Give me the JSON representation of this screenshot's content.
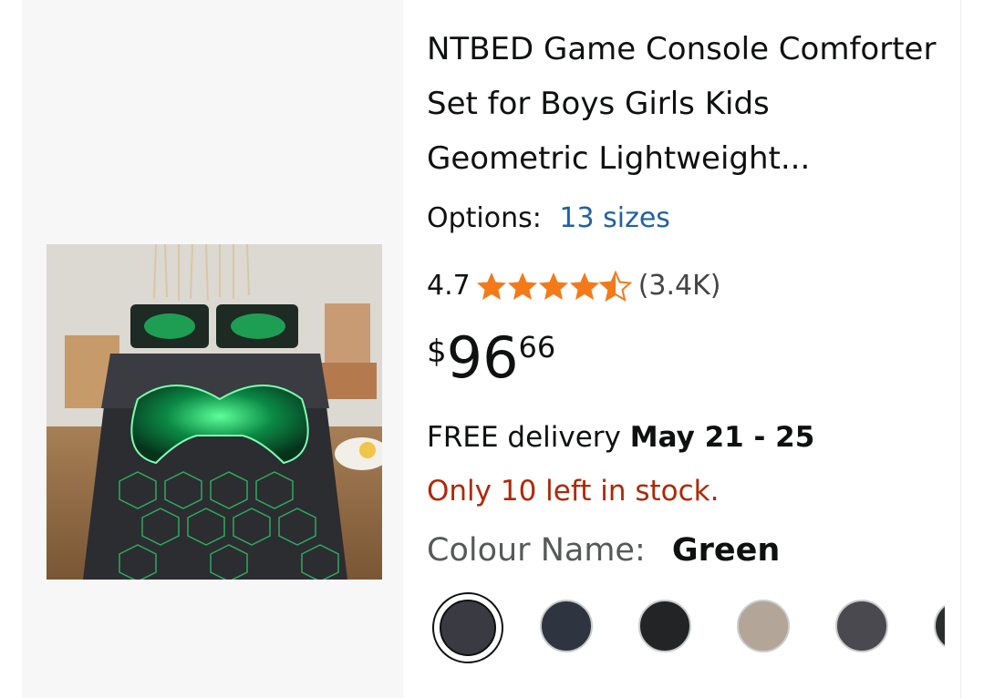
{
  "product": {
    "title": "NTBED Game Console Comforter Set for Boys Girls Kids Geometric Lightweight...",
    "image_alt": "game controller comforter bedding set",
    "options_label": "Options:",
    "options_value": "13 sizes",
    "rating": "4.7",
    "rating_stars": 4.5,
    "rating_count": "(3.4K)",
    "price_currency": "$",
    "price_whole": "96",
    "price_fraction": "66",
    "delivery_prefix": "FREE delivery",
    "delivery_dates": "May 21 - 25",
    "stock_message": "Only 10 left in stock.",
    "colour_label": "Colour Name:",
    "colour_value": "Green"
  },
  "swatches": [
    {
      "name": "swatch-1",
      "color": "#3a3b42",
      "selected": true
    },
    {
      "name": "swatch-2",
      "color": "#2e3540",
      "selected": false
    },
    {
      "name": "swatch-3",
      "color": "#222426",
      "selected": false
    },
    {
      "name": "swatch-4",
      "color": "#b3a597",
      "selected": false
    },
    {
      "name": "swatch-5",
      "color": "#4a494f",
      "selected": false
    },
    {
      "name": "swatch-6",
      "color": "#2c2e2e",
      "selected": false
    }
  ],
  "colors": {
    "link": "#2162a1",
    "stock": "#b12704",
    "star": "#f47a19",
    "text": "#0f1111"
  }
}
